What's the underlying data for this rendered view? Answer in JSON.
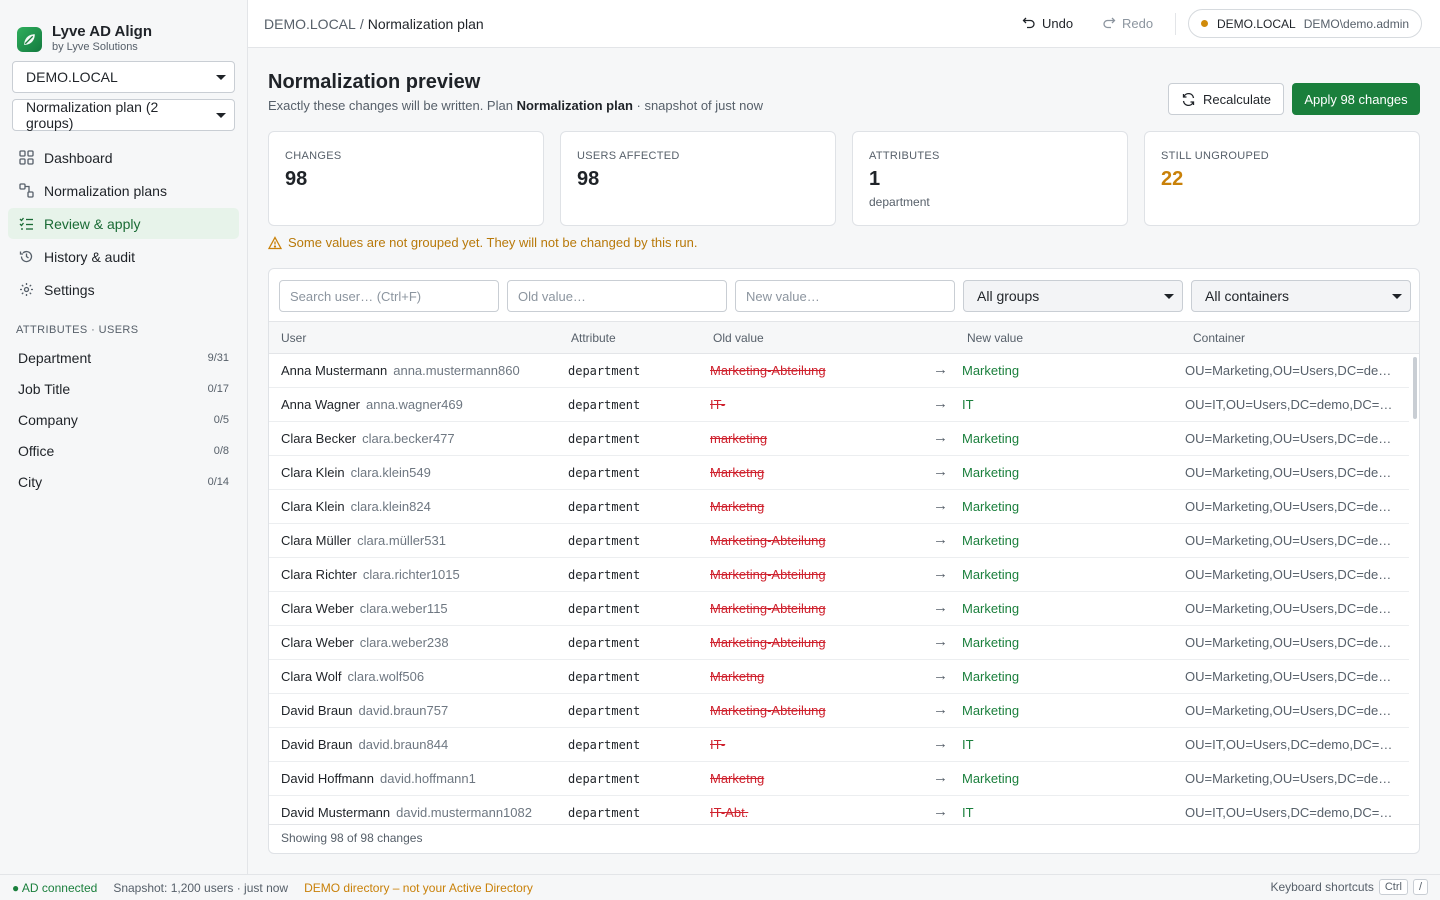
{
  "app": {
    "name": "Lyve AD Align",
    "vendor": "by Lyve Solutions",
    "accent": "#1a7f3c"
  },
  "sidebar": {
    "domain_select": "DEMO.LOCAL",
    "plan_select": "Normalization plan (2 groups)",
    "nav": [
      {
        "label": "Dashboard",
        "icon": "dashboard-icon"
      },
      {
        "label": "Normalization plans",
        "icon": "plans-icon"
      },
      {
        "label": "Review & apply",
        "icon": "review-list-icon",
        "active": true
      },
      {
        "label": "History & audit",
        "icon": "history-icon"
      },
      {
        "label": "Settings",
        "icon": "gear-icon"
      }
    ],
    "section_title": "ATTRIBUTES · USERS",
    "attributes": [
      {
        "label": "Department",
        "count": "9/31"
      },
      {
        "label": "Job Title",
        "count": "0/17"
      },
      {
        "label": "Company",
        "count": "0/5"
      },
      {
        "label": "Office",
        "count": "0/8"
      },
      {
        "label": "City",
        "count": "0/14"
      }
    ]
  },
  "topbar": {
    "breadcrumb": [
      "DEMO.LOCAL",
      "Normalization plan"
    ],
    "undo": "Undo",
    "redo": "Redo",
    "domain": "DEMO.LOCAL",
    "account": "DEMO\\demo.admin"
  },
  "page": {
    "title": "Normalization preview",
    "subtitle_prefix": "Exactly these changes will be written. Plan",
    "plan_name": "Normalization plan",
    "subtitle_suffix": "· snapshot of just now",
    "recalculate": "Recalculate",
    "apply": "Apply 98 changes"
  },
  "stats": [
    {
      "label": "CHANGES",
      "value": "98",
      "sub": ""
    },
    {
      "label": "USERS AFFECTED",
      "value": "98",
      "sub": ""
    },
    {
      "label": "ATTRIBUTES",
      "value": "1",
      "sub": "department"
    },
    {
      "label": "STILL UNGROUPED",
      "value": "22",
      "sub": "",
      "color": "#c98109"
    }
  ],
  "warning": "Some values are not grouped yet. They will not be changed by this run.",
  "filters": {
    "search_placeholder": "Search user… (Ctrl+F)",
    "old_placeholder": "Old value…",
    "new_placeholder": "New value…",
    "groups": "All groups",
    "containers": "All containers"
  },
  "table": {
    "columns": [
      "User",
      "Attribute",
      "Old value",
      "New value",
      "Container"
    ],
    "rows": [
      {
        "name": "Anna Mustermann",
        "login": "anna.mustermann860",
        "attr": "department",
        "old": "Marketing-Abteilung",
        "new": "Marketing",
        "container": "OU=Marketing,OU=Users,DC=demo,DC=local"
      },
      {
        "name": "Anna Wagner",
        "login": "anna.wagner469",
        "attr": "department",
        "old": "IT-",
        "new": "IT",
        "container": "OU=IT,OU=Users,DC=demo,DC=local"
      },
      {
        "name": "Clara Becker",
        "login": "clara.becker477",
        "attr": "department",
        "old": "marketing",
        "new": "Marketing",
        "container": "OU=Marketing,OU=Users,DC=demo,DC=local"
      },
      {
        "name": "Clara Klein",
        "login": "clara.klein549",
        "attr": "department",
        "old": "Marketng",
        "new": "Marketing",
        "container": "OU=Marketing,OU=Users,DC=demo,DC=local"
      },
      {
        "name": "Clara Klein",
        "login": "clara.klein824",
        "attr": "department",
        "old": "Marketng",
        "new": "Marketing",
        "container": "OU=Marketing,OU=Users,DC=demo,DC=local"
      },
      {
        "name": "Clara Müller",
        "login": "clara.müller531",
        "attr": "department",
        "old": "Marketing-Abteilung",
        "new": "Marketing",
        "container": "OU=Marketing,OU=Users,DC=demo,DC=local"
      },
      {
        "name": "Clara Richter",
        "login": "clara.richter1015",
        "attr": "department",
        "old": "Marketing-Abteilung",
        "new": "Marketing",
        "container": "OU=Marketing,OU=Users,DC=demo,DC=local"
      },
      {
        "name": "Clara Weber",
        "login": "clara.weber115",
        "attr": "department",
        "old": "Marketing-Abteilung",
        "new": "Marketing",
        "container": "OU=Marketing,OU=Users,DC=demo,DC=local"
      },
      {
        "name": "Clara Weber",
        "login": "clara.weber238",
        "attr": "department",
        "old": "Marketing-Abteilung",
        "new": "Marketing",
        "container": "OU=Marketing,OU=Users,DC=demo,DC=local"
      },
      {
        "name": "Clara Wolf",
        "login": "clara.wolf506",
        "attr": "department",
        "old": "Marketng",
        "new": "Marketing",
        "container": "OU=Marketing,OU=Users,DC=demo,DC=local"
      },
      {
        "name": "David Braun",
        "login": "david.braun757",
        "attr": "department",
        "old": "Marketing-Abteilung",
        "new": "Marketing",
        "container": "OU=Marketing,OU=Users,DC=demo,DC=local"
      },
      {
        "name": "David Braun",
        "login": "david.braun844",
        "attr": "department",
        "old": "IT-",
        "new": "IT",
        "container": "OU=IT,OU=Users,DC=demo,DC=local"
      },
      {
        "name": "David Hoffmann",
        "login": "david.hoffmann1",
        "attr": "department",
        "old": "Marketng",
        "new": "Marketing",
        "container": "OU=Marketing,OU=Users,DC=demo,DC=local"
      },
      {
        "name": "David Mustermann",
        "login": "david.mustermann1082",
        "attr": "department",
        "old": "IT-Abt.",
        "new": "IT",
        "container": "OU=IT,OU=Users,DC=demo,DC=local"
      }
    ],
    "footer": "Showing 98 of 98 changes"
  },
  "statusbar": {
    "connection": "● AD connected",
    "snapshot": "Snapshot: 1,200 users · just now",
    "demo": "DEMO directory – not your Active Directory",
    "shortcuts": "Keyboard shortcuts",
    "key1": "Ctrl",
    "key2": "/"
  }
}
